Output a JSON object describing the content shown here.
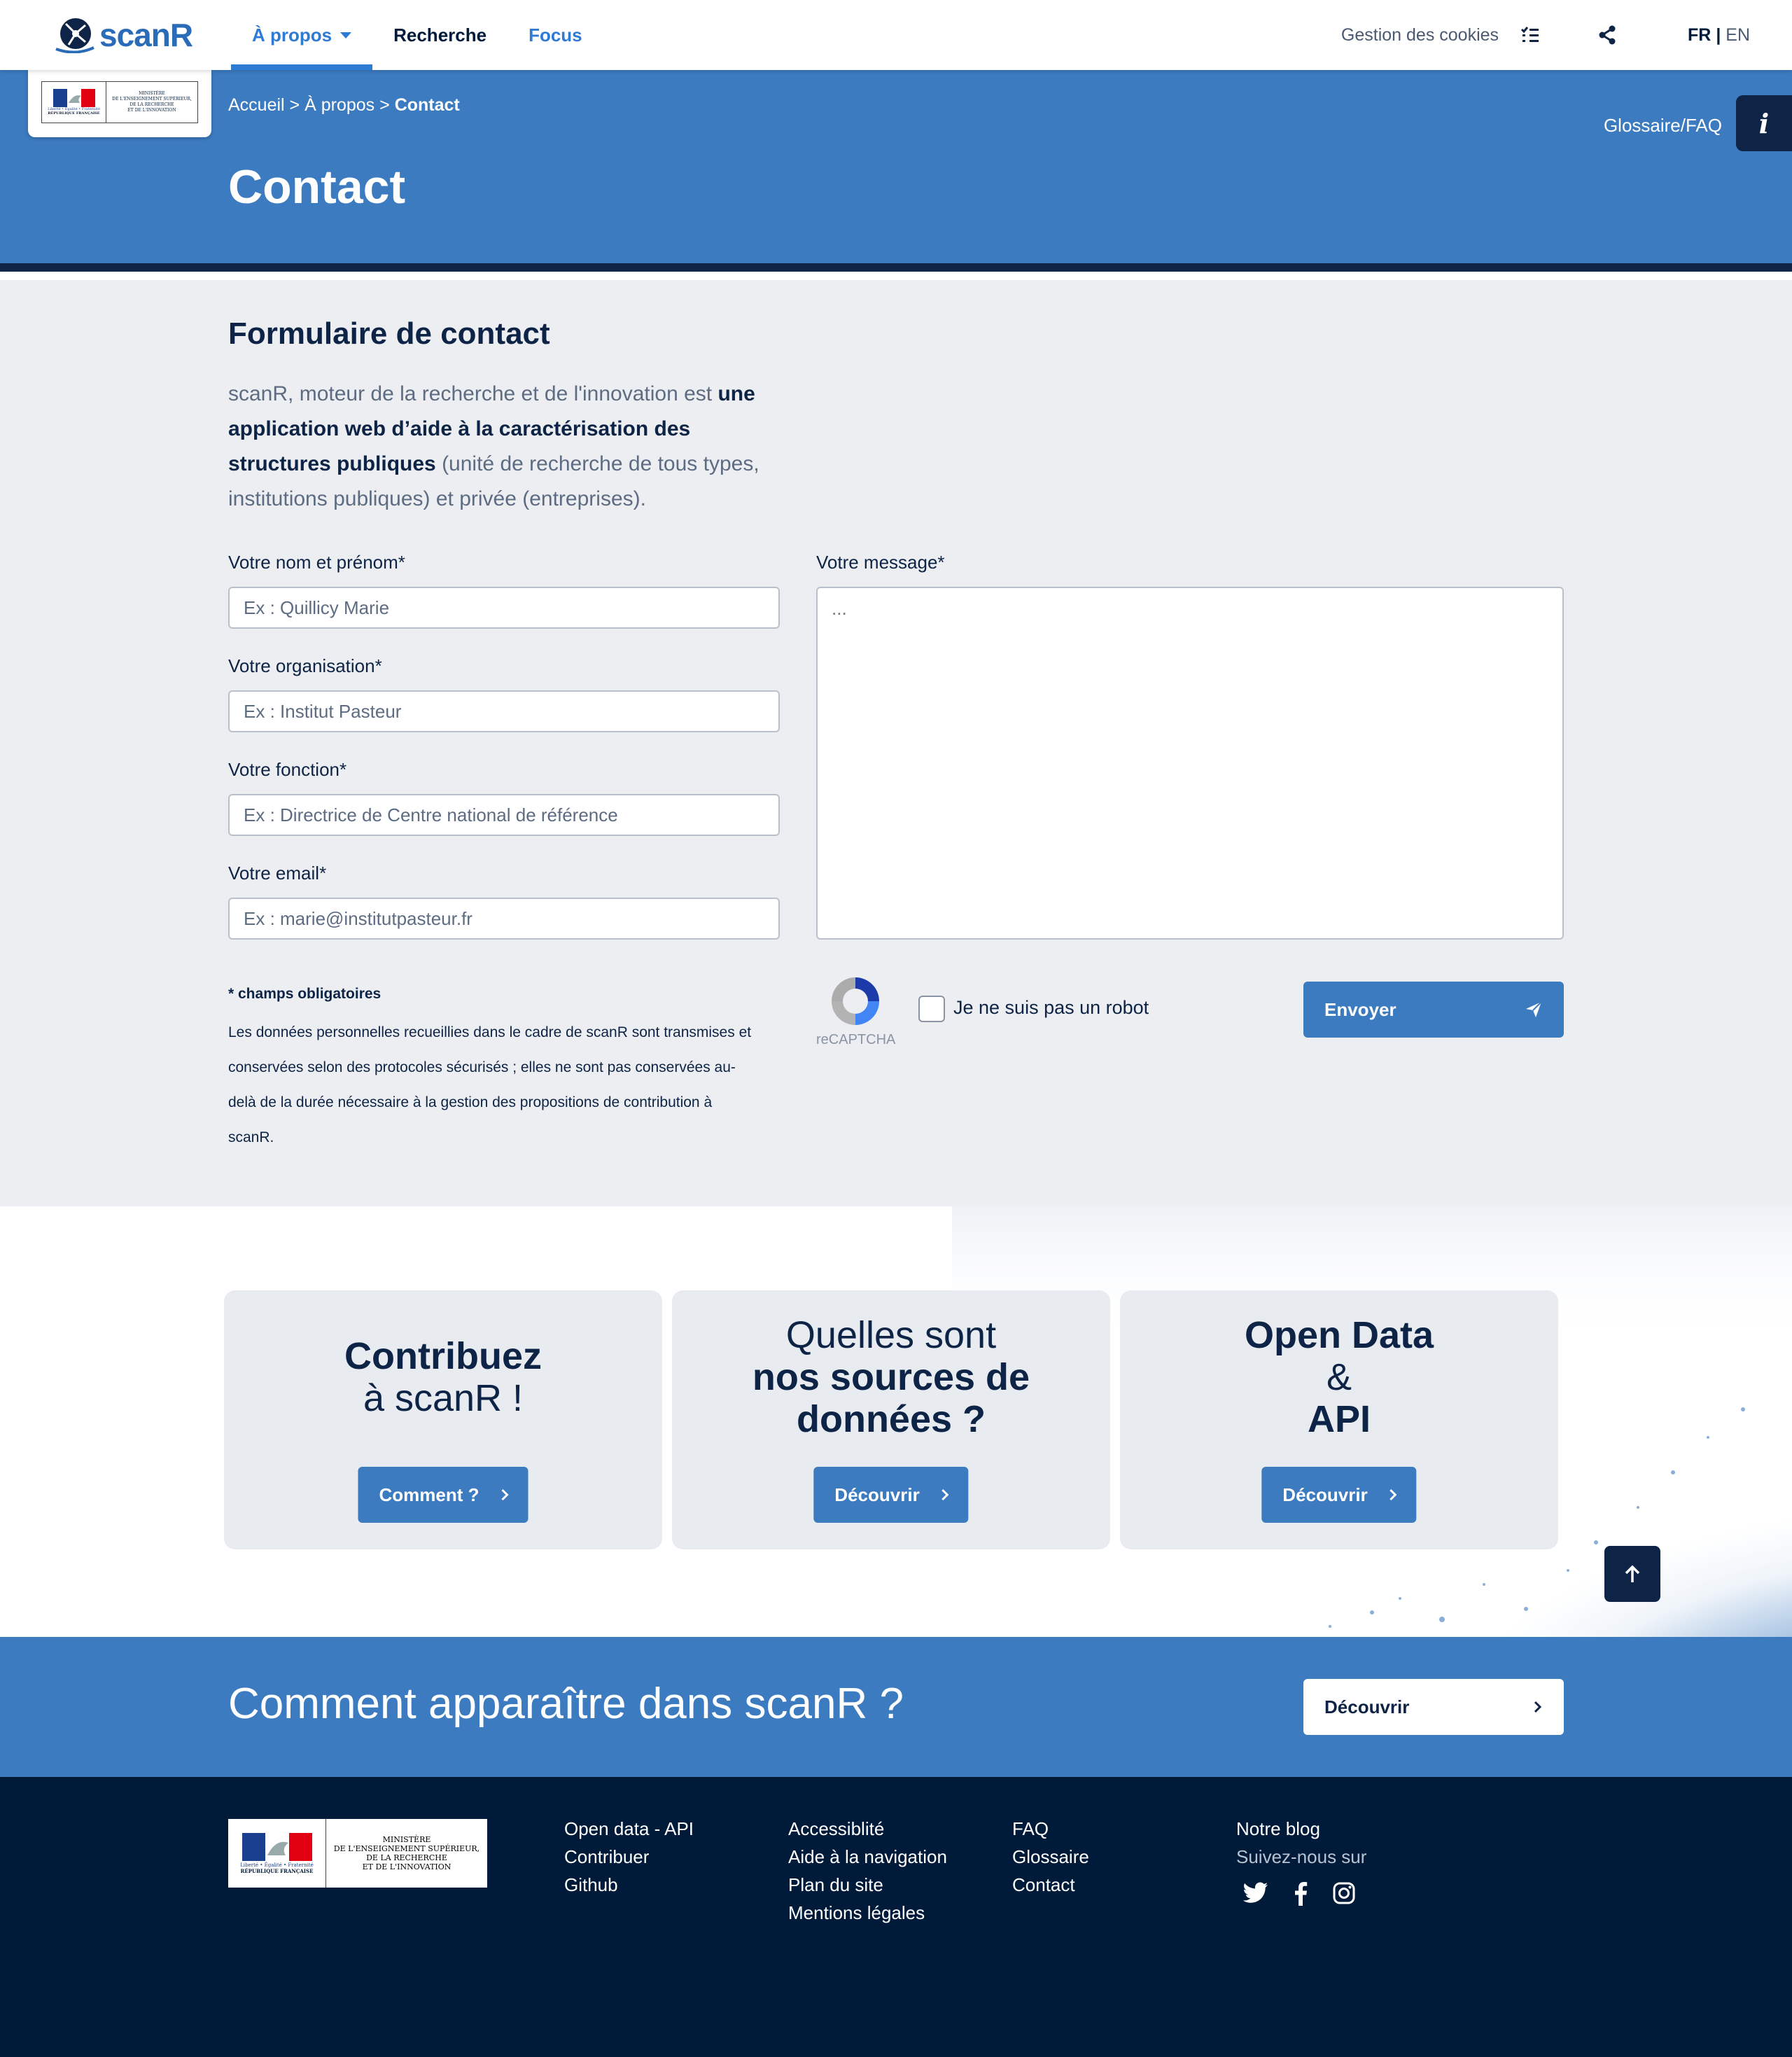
{
  "header": {
    "logo_text": "scanR",
    "nav": [
      {
        "label": "À propos"
      },
      {
        "label": "Recherche"
      },
      {
        "label": "Focus"
      }
    ],
    "cookies_label": "Gestion des cookies",
    "lang_fr": "FR",
    "lang_sep": "|",
    "lang_en": "EN"
  },
  "hero": {
    "breadcrumb": {
      "home": "Accueil",
      "sep1": ">",
      "about": "À propos",
      "sep2": ">",
      "current": "Contact"
    },
    "title": "Contact",
    "glossary_link": "Glossaire/FAQ",
    "info_icon": "i"
  },
  "ministry": {
    "line1": "MINISTÈRE",
    "line2": "DE L'ENSEIGNEMENT SUPÉRIEUR,",
    "line3": "DE LA RECHERCHE",
    "line4": "ET DE L'INNOVATION",
    "motto": "Liberté • Égalité • Fraternité",
    "republic": "RÉPUBLIQUE FRANÇAISE"
  },
  "form": {
    "title": "Formulaire de contact",
    "intro_1": "scanR, moteur de la recherche et de l'innovation est",
    "intro_bold": "une application web d’aide à la caractérisation des structures publiques",
    "intro_2": "(unité de recherche de tous types, institutions publiques) et privée (entreprises).",
    "name_label": "Votre nom et prénom*",
    "name_placeholder": "Ex : Quillicy Marie",
    "org_label": "Votre organisation*",
    "org_placeholder": "Ex : Institut Pasteur",
    "role_label": "Votre fonction*",
    "role_placeholder": "Ex : Directrice de Centre national de référence",
    "email_label": "Votre email*",
    "email_placeholder": "Ex : marie@institutpasteur.fr",
    "message_label": "Votre message*",
    "message_placeholder": "...",
    "required_note": "* champs obligatoires",
    "gdpr_text": "Les données personnelles recueillies dans le cadre de scanR sont transmises et conservées selon des protocoles sécurisés ; elles ne sont pas conservées au-delà de la durée nécessaire à la gestion des propositions de contribution à scanR.",
    "captcha_brand": "reCAPTCHA",
    "captcha_label": "Je ne suis pas un robot",
    "submit_label": "Envoyer"
  },
  "cards": [
    {
      "line1": "Contribuez",
      "line2": "à scanR !",
      "button": "Comment ?"
    },
    {
      "line1": "Quelles sont",
      "line2": "nos sources de",
      "line3": "données ?",
      "button": "Découvrir"
    },
    {
      "line1": "Open Data",
      "line2": "&",
      "line3": "API",
      "button": "Découvrir"
    }
  ],
  "banner": {
    "title": "Comment apparaître dans scanR ?",
    "button": "Découvrir"
  },
  "footer": {
    "col1": [
      "Open data - API",
      "Contribuer",
      "Github"
    ],
    "col2": [
      "Accessiblité",
      "Aide à la navigation",
      "Plan du site",
      "Mentions légales"
    ],
    "col3": [
      "FAQ",
      "Glossaire",
      "Contact"
    ],
    "blog": "Notre blog",
    "follow": "Suivez-nous sur",
    "social_icons": [
      "twitter-icon",
      "facebook-icon",
      "instagram-icon"
    ]
  },
  "colors": {
    "primary": "#3c7bc0",
    "navy": "#001a3a",
    "light_bg": "#eceef1"
  }
}
